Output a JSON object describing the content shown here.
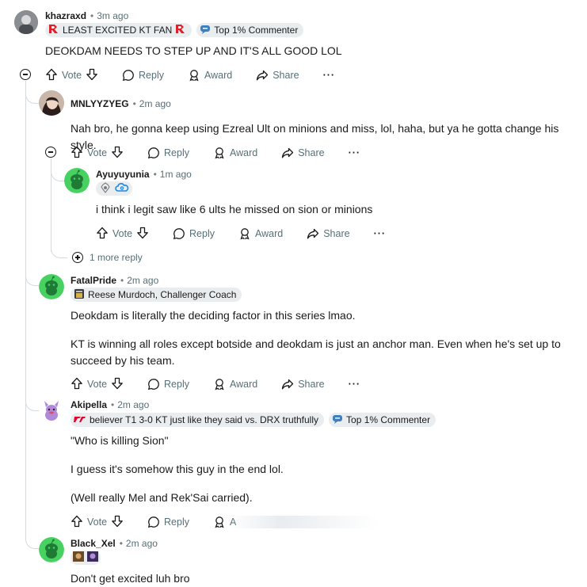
{
  "comments": [
    {
      "author": "khazraxd",
      "time": "3m ago",
      "flairs": [
        {
          "text": "LEAST EXCITED KT FAN"
        },
        {
          "text": "Top 1% Commenter"
        }
      ],
      "body": [
        "DEOKDAM NEEDS TO STEP UP AND IT'S ALL GOOD LOL"
      ]
    },
    {
      "author": "MNLYYZYEG",
      "time": "2m ago",
      "body": [
        "Nah bro, he gonna keep using Ezreal Ult on minions and miss, lol, haha, but ya he gotta change his style."
      ]
    },
    {
      "author": "Ayuyuyunia",
      "time": "1m ago",
      "body": [
        "i think i legit saw like 6 ults he missed on sion or minions"
      ]
    },
    {
      "author": "FatalPride",
      "time": "2m ago",
      "flairs": [
        {
          "text": "Reese Murdoch, Challenger Coach"
        }
      ],
      "body": [
        "Deokdam is literally the deciding factor in this series lmao.",
        "KT is winning all roles except botside and deokdam is just an anchor man. Even when he's set up to succeed by his team."
      ]
    },
    {
      "author": "Akipella",
      "time": "2m ago",
      "flairs": [
        {
          "text": "believer T1 3-0 KT just like they said vs. DRX truthfully"
        },
        {
          "text": "Top 1% Commenter"
        }
      ],
      "body": [
        "\"Who is killing Sion\"",
        "I guess it's somehow this guy in the end lol.",
        "(Well really Mel and Rek'Sai carried)."
      ]
    },
    {
      "author": "Black_Xel",
      "time": "2m ago",
      "body": [
        "Don't get excited luh bro"
      ]
    }
  ],
  "actions": {
    "vote": "Vote",
    "reply": "Reply",
    "award": "Award",
    "share": "Share",
    "more": "···",
    "award_partial": "A"
  },
  "more_replies": "1 more reply",
  "separator": "•",
  "colors": {
    "bg": "#ffffff",
    "text": "#1a1a1b",
    "meta": "#576f76",
    "flair_bg": "#eaedef",
    "thread_line": "#d7dadc",
    "snoo_green": "#46d160",
    "kt_red": "#e0202b"
  }
}
